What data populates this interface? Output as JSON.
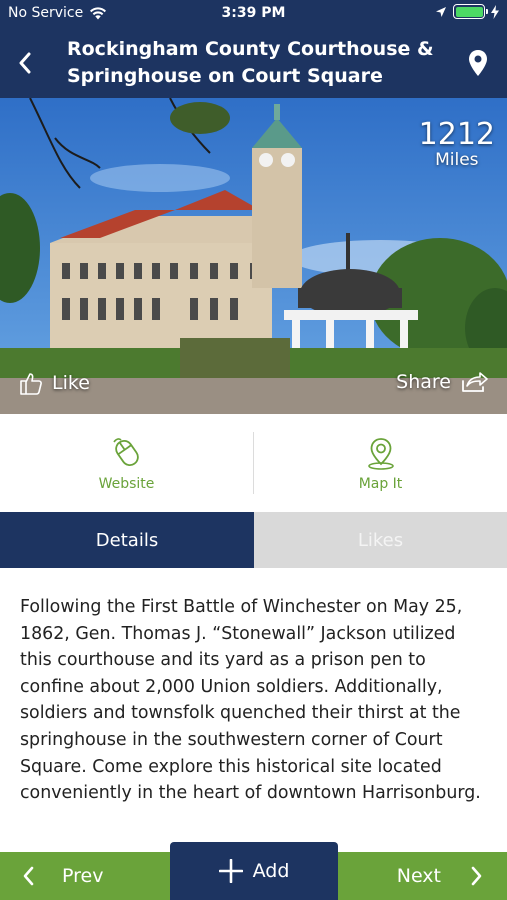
{
  "status_bar": {
    "carrier": "No Service",
    "time": "3:39 PM",
    "icons": [
      "wifi-icon",
      "location-arrow-icon",
      "battery-icon",
      "charging-bolt-icon"
    ]
  },
  "nav": {
    "title": "Rockingham County Courthouse & Springhouse on Court Square",
    "back_icon": "chevron-left-icon",
    "map_pin_icon": "map-pin-icon",
    "background_color": "#1d3461"
  },
  "hero": {
    "distance_value": "1212",
    "distance_unit": "Miles",
    "like_label": "Like",
    "share_label": "Share"
  },
  "actions": [
    {
      "label": "Website",
      "icon": "mouse-icon"
    },
    {
      "label": "Map It",
      "icon": "location-pin-icon"
    }
  ],
  "tabs": [
    {
      "label": "Details",
      "active": true
    },
    {
      "label": "Likes",
      "active": false
    }
  ],
  "description": "Following the First Battle of Winchester on May 25, 1862, Gen. Thomas J. “Stonewall” Jackson utilized this courthouse and its yard as a prison pen to confine about 2,000 Union soldiers. Additionally, soldiers and townsfolk quenched their thirst at the springhouse in the southwestern corner of Court Square. Come explore this historical site located conveniently in the heart of downtown Harrisonburg.",
  "bottom_bar": {
    "prev_label": "Prev",
    "add_label": "Add",
    "next_label": "Next",
    "accent_color": "#6aa33a"
  }
}
